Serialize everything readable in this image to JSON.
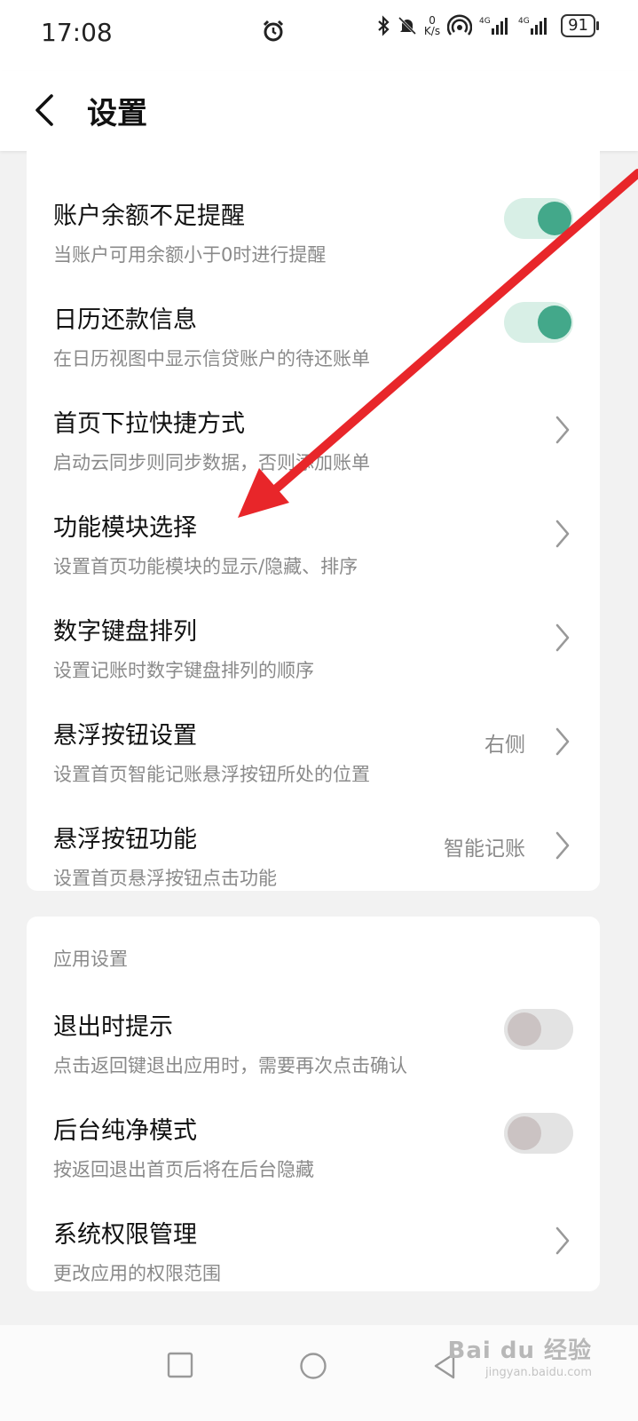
{
  "status_bar": {
    "time": "17:08",
    "net_speed_value": "0",
    "net_speed_unit": "K/s",
    "sim1": "4G",
    "sim2": "4G",
    "battery": "91"
  },
  "header": {
    "title": "设置",
    "back_icon": "chevron-left-icon"
  },
  "section1": {
    "rows": [
      {
        "title": "账户余额不足提醒",
        "subtitle": "当账户可用余额小于0时进行提醒",
        "control": "toggle",
        "enabled": true
      },
      {
        "title": "日历还款信息",
        "subtitle": "在日历视图中显示信贷账户的待还账单",
        "control": "toggle",
        "enabled": true
      },
      {
        "title": "首页下拉快捷方式",
        "subtitle": "启动云同步则同步数据，否则添加账单",
        "control": "chevron"
      },
      {
        "title": "功能模块选择",
        "subtitle": "设置首页功能模块的显示/隐藏、排序",
        "control": "chevron"
      },
      {
        "title": "数字键盘排列",
        "subtitle": "设置记账时数字键盘排列的顺序",
        "control": "chevron"
      },
      {
        "title": "悬浮按钮设置",
        "subtitle": "设置首页智能记账悬浮按钮所处的位置",
        "value": "右侧",
        "control": "chevron"
      },
      {
        "title": "悬浮按钮功能",
        "subtitle": "设置首页悬浮按钮点击功能",
        "value": "智能记账",
        "control": "chevron"
      }
    ]
  },
  "section2": {
    "label": "应用设置",
    "rows": [
      {
        "title": "退出时提示",
        "subtitle": "点击返回键退出应用时，需要再次点击确认",
        "control": "toggle",
        "enabled": false
      },
      {
        "title": "后台纯净模式",
        "subtitle": "按返回退出首页后将在后台隐藏",
        "control": "toggle",
        "enabled": false
      },
      {
        "title": "系统权限管理",
        "subtitle": "更改应用的权限范围",
        "control": "chevron"
      }
    ]
  },
  "nav_bar": {
    "buttons": [
      "recent-apps-icon",
      "home-icon",
      "back-icon"
    ]
  },
  "watermark": {
    "text": "Bai du 经验",
    "sub": "jingyan.baidu.com"
  },
  "colors": {
    "toggle_on_track": "#d8efe6",
    "toggle_on_knob": "#43a88a",
    "toggle_off_track": "#e3e3e3",
    "annotation_arrow": "#e8262a"
  }
}
